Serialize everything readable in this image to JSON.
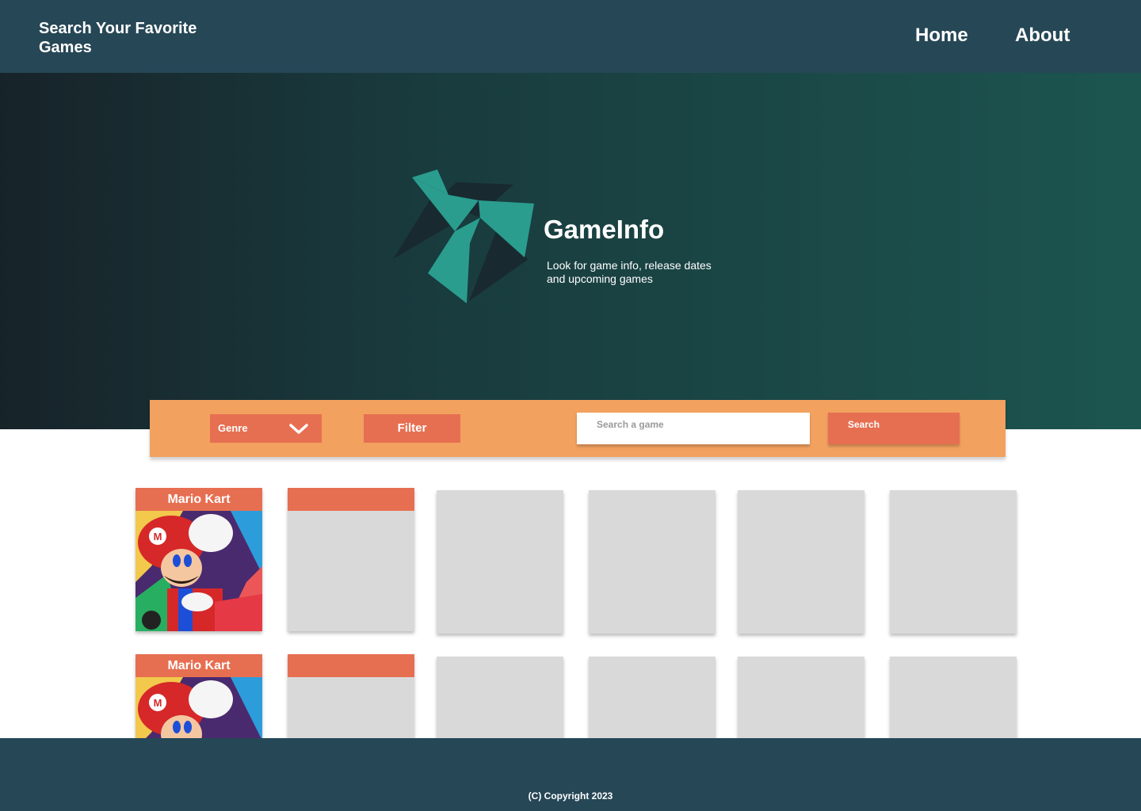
{
  "header": {
    "brand": "Search Your Favorite Games",
    "nav": [
      {
        "label": "Home"
      },
      {
        "label": "About"
      }
    ]
  },
  "hero": {
    "title": "GameInfo",
    "subtitle": "Look for game info, release dates and upcoming games"
  },
  "search_bar": {
    "genre_label": "Genre",
    "filter_label": "Filter",
    "search_placeholder": "Search a game",
    "search_label": "Search"
  },
  "games": [
    {
      "title": "Mario Kart"
    },
    {
      "title": ""
    },
    {
      "title": "Mario Kart"
    },
    {
      "title": ""
    }
  ],
  "footer": {
    "copyright": "(C) Copyright 2023"
  },
  "colors": {
    "navy": "#264756",
    "accent": "#e76f51",
    "bar": "#f2a15f",
    "teal": "#2a9d8f",
    "card": "#d9d9d9"
  }
}
